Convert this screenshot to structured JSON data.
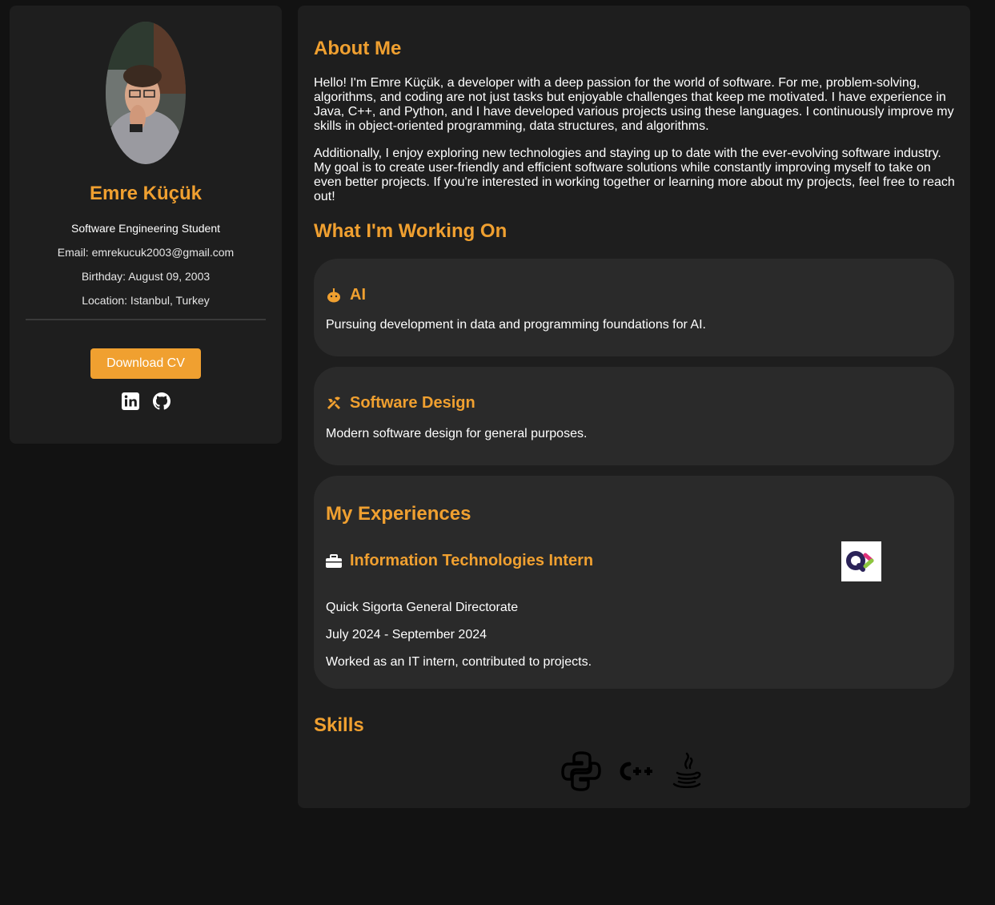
{
  "profile": {
    "name": "Emre Küçük",
    "title": "Software Engineering Student",
    "email": "Email: emrekucuk2003@gmail.com",
    "birthday": "Birthday: August 09, 2003",
    "location": "Location: Istanbul, Turkey",
    "download_label": "Download CV",
    "social": [
      "linkedin-icon",
      "github-icon"
    ]
  },
  "about": {
    "title": "About Me",
    "paragraphs": [
      "Hello! I'm Emre Küçük, a developer with a deep passion for the world of software. For me, problem-solving, algorithms, and coding are not just tasks but enjoyable challenges that keep me motivated. I have experience in Java, C++, and Python, and I have developed various projects using these languages. I continuously improve my skills in object-oriented programming, data structures, and algorithms.",
      "Additionally, I enjoy exploring new technologies and staying up to date with the ever-evolving software industry. My goal is to create user-friendly and efficient software solutions while constantly improving myself to take on even better projects. If you're interested in working together or learning more about my projects, feel free to reach out!"
    ]
  },
  "working_on": {
    "title": "What I'm Working On",
    "items": [
      {
        "icon": "robot-icon",
        "title": "AI",
        "text": "Pursuing development in data and programming foundations for AI."
      },
      {
        "icon": "tools-icon",
        "title": "Software Design",
        "text": "Modern software design for general purposes."
      }
    ]
  },
  "experiences": {
    "title": "My Experiences",
    "items": [
      {
        "icon": "briefcase-icon",
        "role": "Information Technologies Intern",
        "company": "Quick Sigorta General Directorate",
        "dates": "July 2024 - September 2024",
        "description": "Worked as an IT intern, contributed to projects.",
        "logo": "quick-sigorta-logo"
      }
    ]
  },
  "skills": {
    "title": "Skills",
    "icons": [
      "python-icon",
      "cplusplus-icon",
      "java-icon"
    ]
  },
  "colors": {
    "background": "#121212",
    "panel": "#1e1e1e",
    "card": "#2a2a2a",
    "accent": "#f0a030",
    "text": "#ffffff"
  }
}
